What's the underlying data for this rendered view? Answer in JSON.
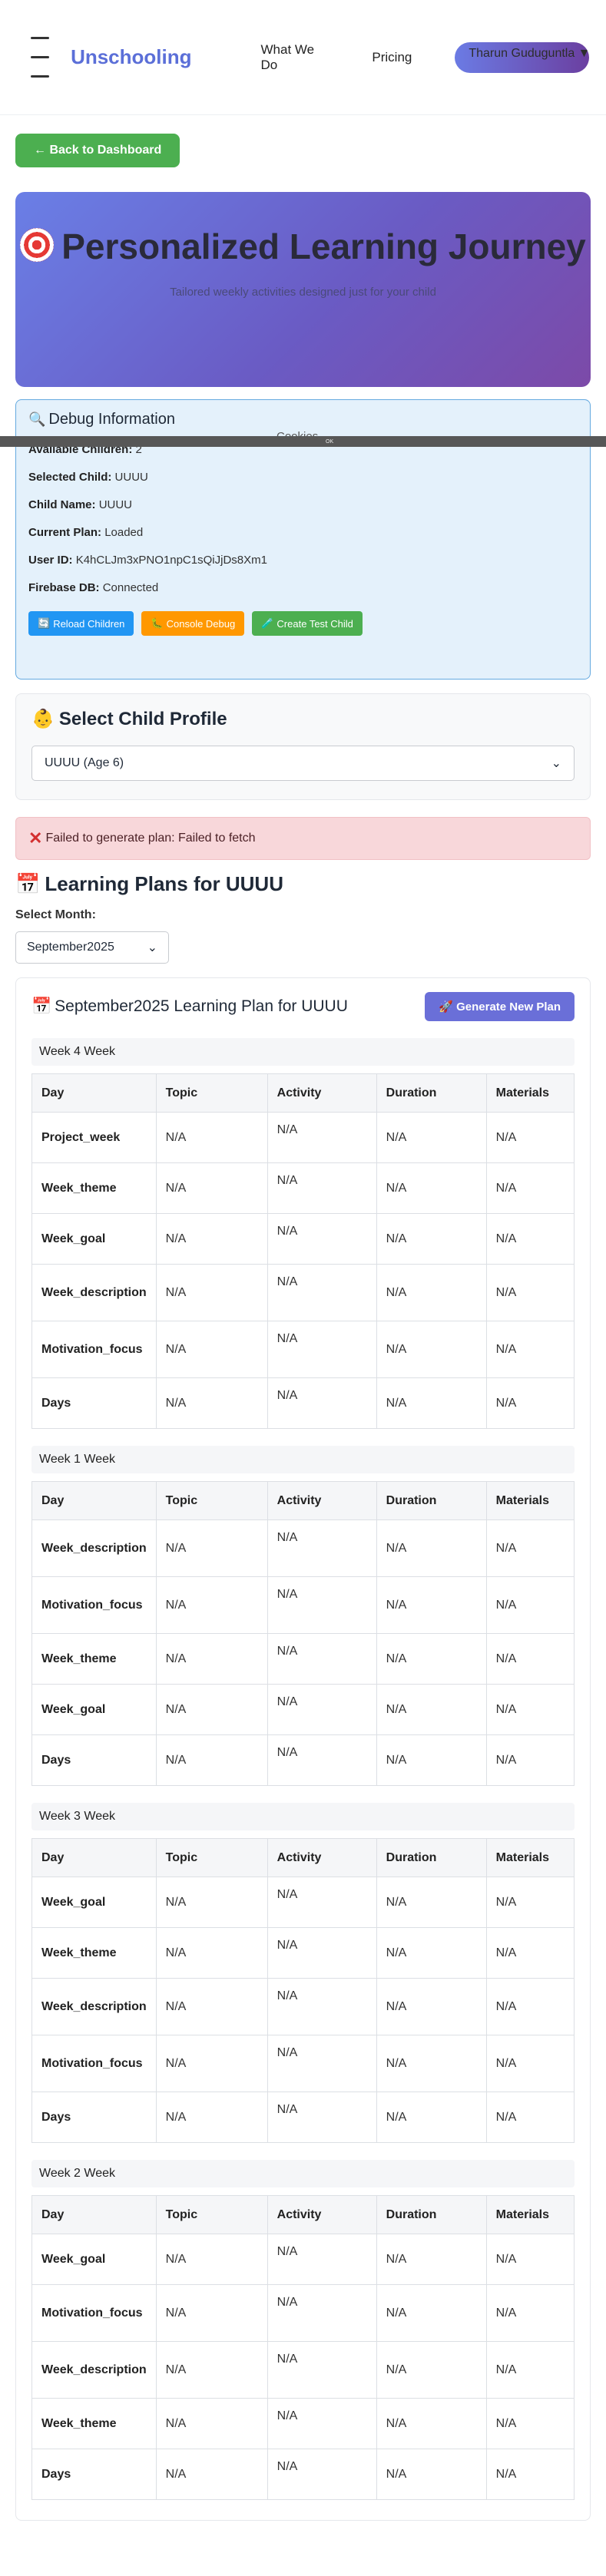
{
  "header": {
    "brand": "Unschooling",
    "nav": [
      "What We Do",
      "Pricing"
    ],
    "user": "Tharun Guduguntla ▼"
  },
  "back_button": "← Back to Dashboard",
  "hero": {
    "title": "Personalized Learning Journey",
    "subtitle": "Tailored weekly activities designed just for your child"
  },
  "cookie": {
    "text": "Cookies",
    "ok": "OK"
  },
  "debug": {
    "title": "Debug Information",
    "rows": [
      {
        "label": "Available Children:",
        "value": "2"
      },
      {
        "label": "Selected Child:",
        "value": "UUUU"
      },
      {
        "label": "Child Name:",
        "value": "UUUU"
      },
      {
        "label": "Current Plan:",
        "value": "Loaded"
      },
      {
        "label": "User ID:",
        "value": "K4hCLJm3xPNO1npC1sQiJjDs8Xm1"
      },
      {
        "label": "Firebase DB:",
        "value": "Connected"
      }
    ],
    "buttons": [
      "Reload Children",
      "Console Debug",
      "Create Test Child"
    ]
  },
  "child_select": {
    "title": "Select Child Profile",
    "value": "UUUU (Age 6)"
  },
  "error": "Failed to generate plan: Failed to fetch",
  "plans_title": "Learning Plans for UUUU",
  "month": {
    "label": "Select Month:",
    "value": "September2025"
  },
  "plan": {
    "title": "September2025 Learning Plan for UUUU",
    "generate_button": "Generate New Plan",
    "columns": [
      "Day",
      "Topic",
      "Activity",
      "Duration",
      "Materials"
    ],
    "weeks": [
      {
        "title": "Week 4 Week",
        "rows": [
          "Project_week",
          "Week_theme",
          "Week_goal",
          "Week_description",
          "Motivation_focus",
          "Days"
        ]
      },
      {
        "title": "Week 1 Week",
        "rows": [
          "Week_description",
          "Motivation_focus",
          "Week_theme",
          "Week_goal",
          "Days"
        ]
      },
      {
        "title": "Week 3 Week",
        "rows": [
          "Week_goal",
          "Week_theme",
          "Week_description",
          "Motivation_focus",
          "Days"
        ]
      },
      {
        "title": "Week 2 Week",
        "rows": [
          "Week_goal",
          "Motivation_focus",
          "Week_description",
          "Week_theme",
          "Days"
        ]
      }
    ],
    "cell_value": "N/A"
  }
}
